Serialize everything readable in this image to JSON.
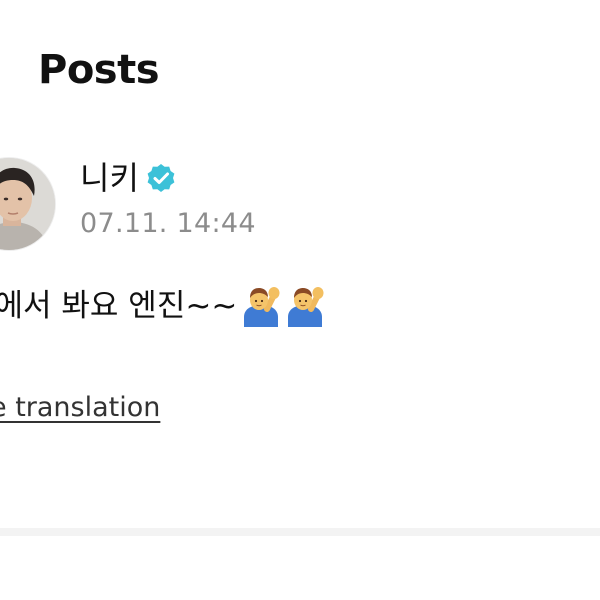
{
  "header": {
    "title": "Posts"
  },
  "post": {
    "author": {
      "name": "니키",
      "verified": true,
      "verified_color": "#3cc1d8",
      "avatar_icon": "profile-photo"
    },
    "timestamp": "07.11. 14:44",
    "text": "뱅에서 봐요 엔진~~",
    "emojis": [
      "person-raising-hand-emoji",
      "person-raising-hand-emoji"
    ],
    "translation_link": "e translation"
  }
}
